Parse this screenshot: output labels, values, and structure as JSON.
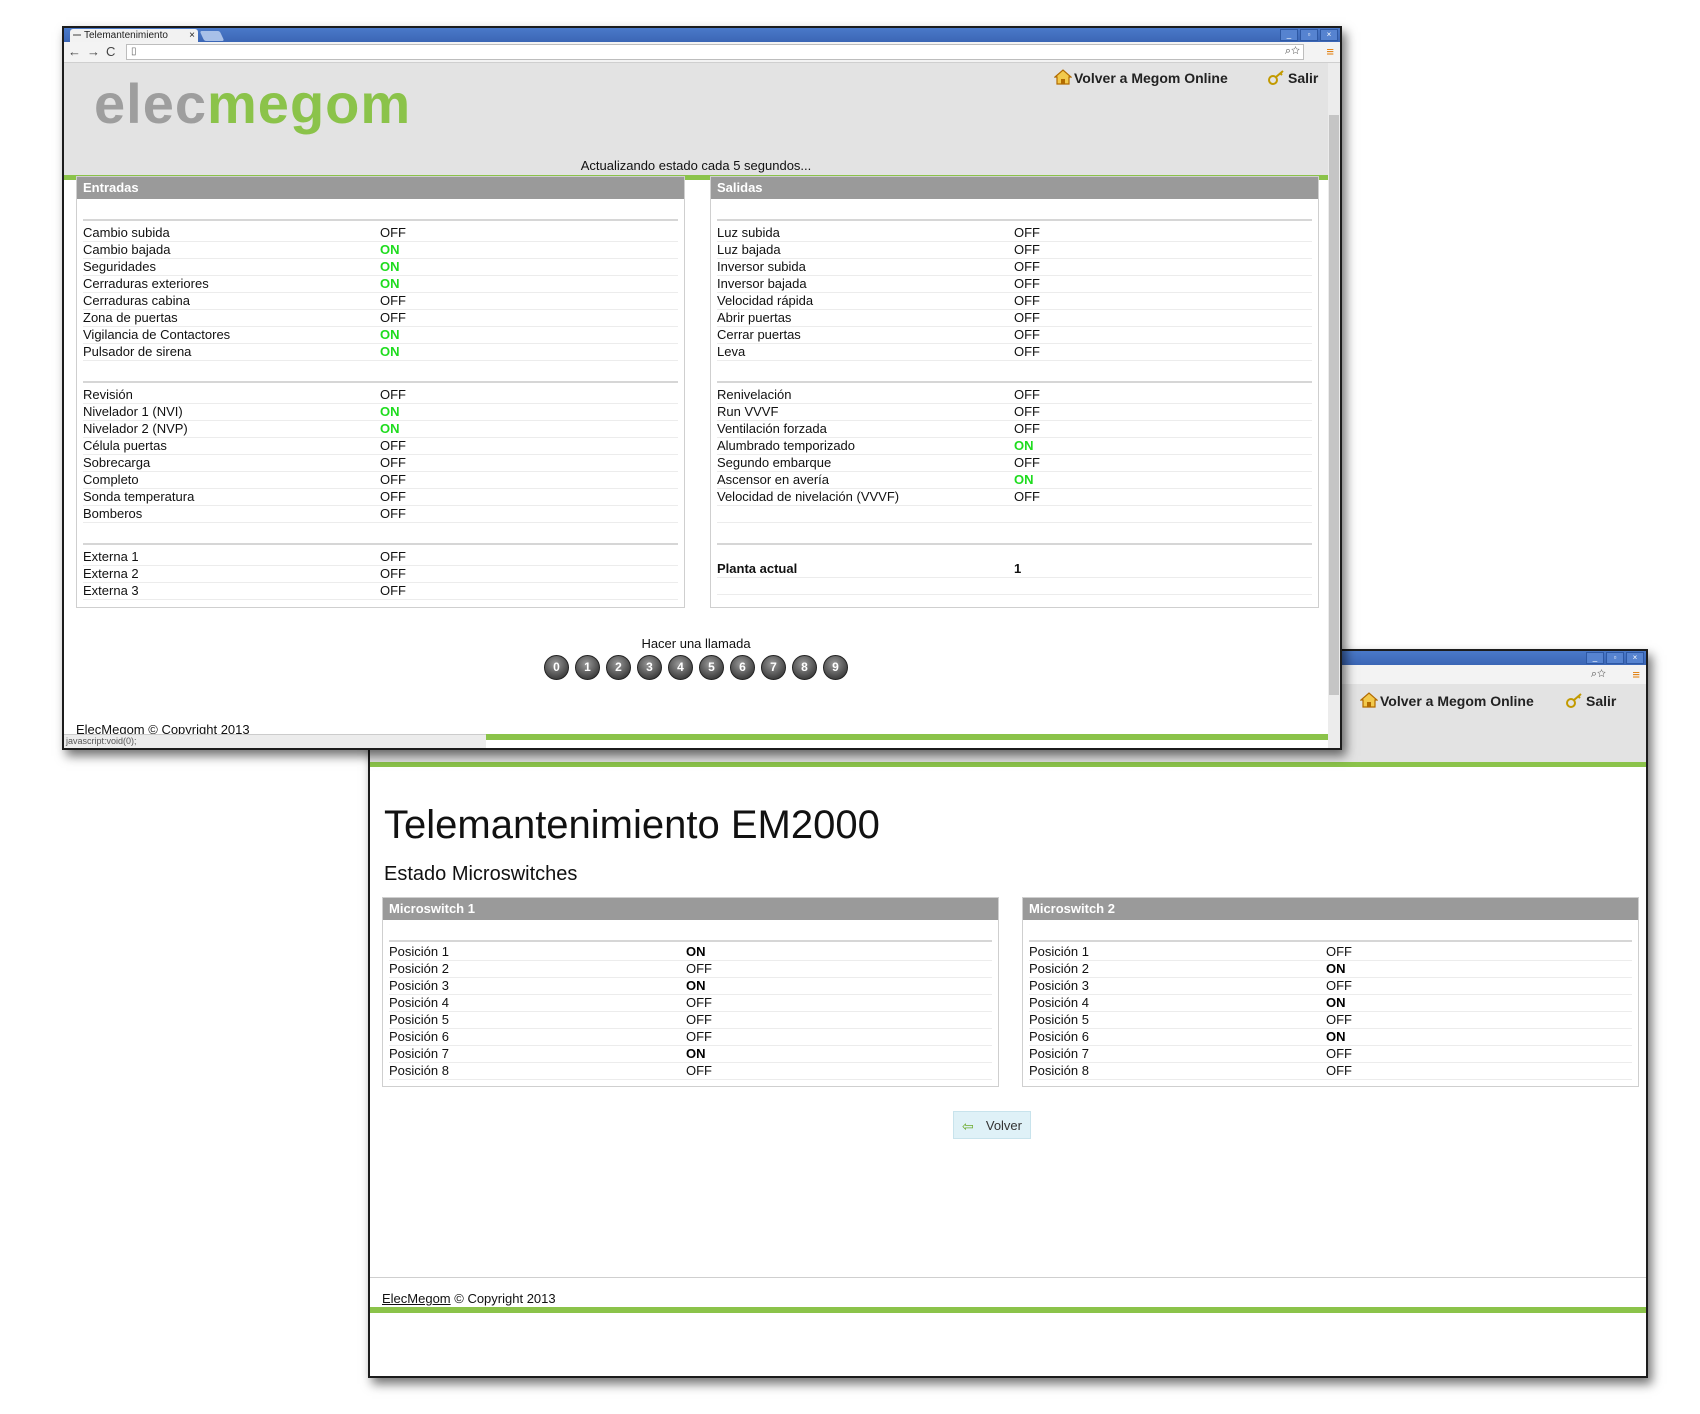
{
  "browser": {
    "tab_title": "Telemantenimiento",
    "tab_close": "×",
    "window_buttons": [
      "_",
      "▫",
      "×"
    ],
    "nav_glyphs": "←→C"
  },
  "header": {
    "logo_part1": "elec",
    "logo_part2": "megom",
    "volver_online": "Volver a Megom Online",
    "salir": "Salir"
  },
  "status_text": "Actualizando estado cada 5 segundos...",
  "entradas": {
    "title": "Entradas",
    "groups": [
      [
        {
          "label": "Cambio subida",
          "value": "OFF"
        },
        {
          "label": "Cambio bajada",
          "value": "ON"
        },
        {
          "label": "Seguridades",
          "value": "ON"
        },
        {
          "label": "Cerraduras exteriores",
          "value": "ON"
        },
        {
          "label": "Cerraduras cabina",
          "value": "OFF"
        },
        {
          "label": "Zona de puertas",
          "value": "OFF"
        },
        {
          "label": "Vigilancia de Contactores",
          "value": "ON"
        },
        {
          "label": "Pulsador de sirena",
          "value": "ON"
        }
      ],
      [
        {
          "label": "Revisión",
          "value": "OFF"
        },
        {
          "label": "Nivelador 1 (NVI)",
          "value": "ON"
        },
        {
          "label": "Nivelador 2 (NVP)",
          "value": "ON"
        },
        {
          "label": "Célula puertas",
          "value": "OFF"
        },
        {
          "label": "Sobrecarga",
          "value": "OFF"
        },
        {
          "label": "Completo",
          "value": "OFF"
        },
        {
          "label": "Sonda temperatura",
          "value": "OFF"
        },
        {
          "label": "Bomberos",
          "value": "OFF"
        }
      ],
      [
        {
          "label": "Externa 1",
          "value": "OFF"
        },
        {
          "label": "Externa 2",
          "value": "OFF"
        },
        {
          "label": "Externa 3",
          "value": "OFF"
        }
      ]
    ]
  },
  "salidas": {
    "title": "Salidas",
    "groups": [
      [
        {
          "label": "Luz subida",
          "value": "OFF"
        },
        {
          "label": "Luz bajada",
          "value": "OFF"
        },
        {
          "label": "Inversor subida",
          "value": "OFF"
        },
        {
          "label": "Inversor bajada",
          "value": "OFF"
        },
        {
          "label": "Velocidad rápida",
          "value": "OFF"
        },
        {
          "label": "Abrir puertas",
          "value": "OFF"
        },
        {
          "label": "Cerrar puertas",
          "value": "OFF"
        },
        {
          "label": "Leva",
          "value": "OFF"
        }
      ],
      [
        {
          "label": "Renivelación",
          "value": "OFF"
        },
        {
          "label": "Run VVVF",
          "value": "OFF"
        },
        {
          "label": "Ventilación forzada",
          "value": "OFF"
        },
        {
          "label": "Alumbrado temporizado",
          "value": "ON"
        },
        {
          "label": "Segundo embarque",
          "value": "OFF"
        },
        {
          "label": "Ascensor en avería",
          "value": "ON"
        },
        {
          "label": "Velocidad de nivelación (VVVF)",
          "value": "OFF"
        }
      ]
    ],
    "planta_label": "Planta actual",
    "planta_value": "1"
  },
  "call": {
    "label": "Hacer una llamada",
    "keys": [
      "0",
      "1",
      "2",
      "3",
      "4",
      "5",
      "6",
      "7",
      "8",
      "9"
    ]
  },
  "footer": {
    "brand": "ElecMegom",
    "copyright": " © Copyright 2013",
    "status_url": "javascript:void(0);"
  },
  "micro": {
    "title": "Telemantenimiento EM2000",
    "subtitle": "Estado Microswitches",
    "panels": [
      {
        "title": "Microswitch 1",
        "rows": [
          {
            "label": "Posición 1",
            "value": "ON"
          },
          {
            "label": "Posición 2",
            "value": "OFF"
          },
          {
            "label": "Posición 3",
            "value": "ON"
          },
          {
            "label": "Posición 4",
            "value": "OFF"
          },
          {
            "label": "Posición 5",
            "value": "OFF"
          },
          {
            "label": "Posición 6",
            "value": "OFF"
          },
          {
            "label": "Posición 7",
            "value": "ON"
          },
          {
            "label": "Posición 8",
            "value": "OFF"
          }
        ]
      },
      {
        "title": "Microswitch 2",
        "rows": [
          {
            "label": "Posición 1",
            "value": "OFF"
          },
          {
            "label": "Posición 2",
            "value": "ON"
          },
          {
            "label": "Posición 3",
            "value": "OFF"
          },
          {
            "label": "Posición 4",
            "value": "ON"
          },
          {
            "label": "Posición 5",
            "value": "OFF"
          },
          {
            "label": "Posición 6",
            "value": "ON"
          },
          {
            "label": "Posición 7",
            "value": "OFF"
          },
          {
            "label": "Posición 8",
            "value": "OFF"
          }
        ]
      }
    ],
    "volver_label": "Volver"
  },
  "colors": {
    "accent_green": "#8bc34a",
    "on_green": "#1edc1e",
    "panel_header": "#9a9a9a",
    "chrome_blue": "#3b66b5"
  }
}
